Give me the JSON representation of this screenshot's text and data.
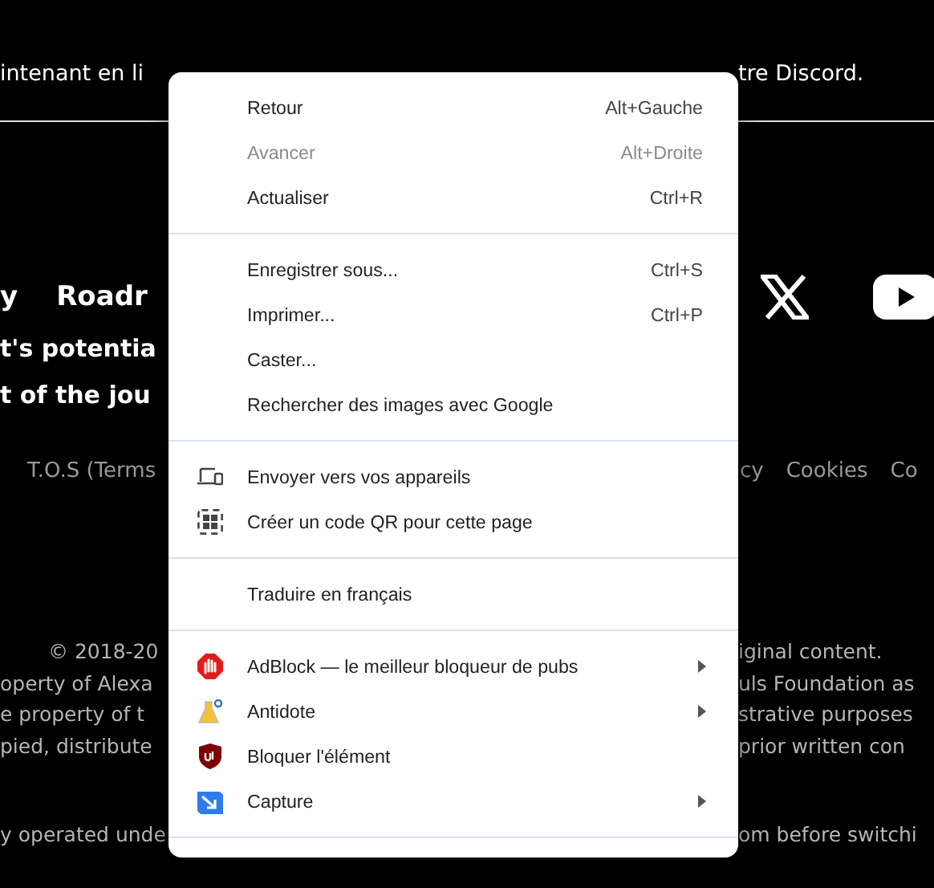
{
  "page": {
    "rows": [
      {
        "kind": "lead",
        "left": [
          "intenant en li"
        ],
        "right": [
          "tre Discord."
        ]
      },
      {
        "kind": "nav",
        "left": [
          "y",
          "Roadr"
        ],
        "right": []
      },
      {
        "kind": "body",
        "left": [
          "t's potentia"
        ],
        "right": []
      },
      {
        "kind": "body",
        "left": [
          "t of the jou"
        ],
        "right": []
      },
      {
        "kind": "links",
        "left": [
          "T.O.S (Terms"
        ],
        "right": [
          "cy",
          "Cookies",
          "Co"
        ]
      },
      {
        "kind": "footer",
        "left": [
          "© 2018-20"
        ],
        "right": [
          "iginal content."
        ]
      },
      {
        "kind": "footer",
        "left": [
          "operty of Alexa"
        ],
        "right": [
          "uls Foundation as"
        ]
      },
      {
        "kind": "footer",
        "left": [
          "e property of t"
        ],
        "right": [
          "strative purposes"
        ]
      },
      {
        "kind": "footer",
        "left": [
          "pied, distribute"
        ],
        "right": [
          "prior written con"
        ]
      },
      {
        "kind": "footer",
        "left": [
          "y operated unde"
        ],
        "right": [
          "om before switchi"
        ]
      }
    ]
  },
  "context_menu": {
    "sections": [
      {
        "items": [
          {
            "label": "Retour",
            "shortcut": "Alt+Gauche",
            "disabled": false,
            "submenu": false
          },
          {
            "label": "Avancer",
            "shortcut": "Alt+Droite",
            "disabled": true,
            "submenu": false
          },
          {
            "label": "Actualiser",
            "shortcut": "Ctrl+R",
            "disabled": false,
            "submenu": false
          }
        ]
      },
      {
        "items": [
          {
            "label": "Enregistrer sous...",
            "shortcut": "Ctrl+S",
            "disabled": false,
            "submenu": false
          },
          {
            "label": "Imprimer...",
            "shortcut": "Ctrl+P",
            "disabled": false,
            "submenu": false
          },
          {
            "label": "Caster...",
            "disabled": false,
            "submenu": false
          },
          {
            "label": "Rechercher des images avec Google",
            "disabled": false,
            "submenu": false
          }
        ]
      },
      {
        "items": [
          {
            "label": "Envoyer vers vos appareils",
            "disabled": false,
            "submenu": false
          },
          {
            "label": "Créer un code QR pour cette page",
            "disabled": false,
            "submenu": false
          }
        ]
      },
      {
        "items": [
          {
            "label": "Traduire en français",
            "disabled": false,
            "submenu": false
          }
        ]
      },
      {
        "items": [
          {
            "label": "AdBlock — le meilleur bloqueur de pubs",
            "disabled": false,
            "submenu": true
          },
          {
            "label": "Antidote",
            "disabled": false,
            "submenu": true
          },
          {
            "label": "Bloquer l'élément",
            "disabled": false,
            "submenu": false
          },
          {
            "label": "Capture",
            "disabled": false,
            "submenu": true
          }
        ]
      }
    ]
  }
}
